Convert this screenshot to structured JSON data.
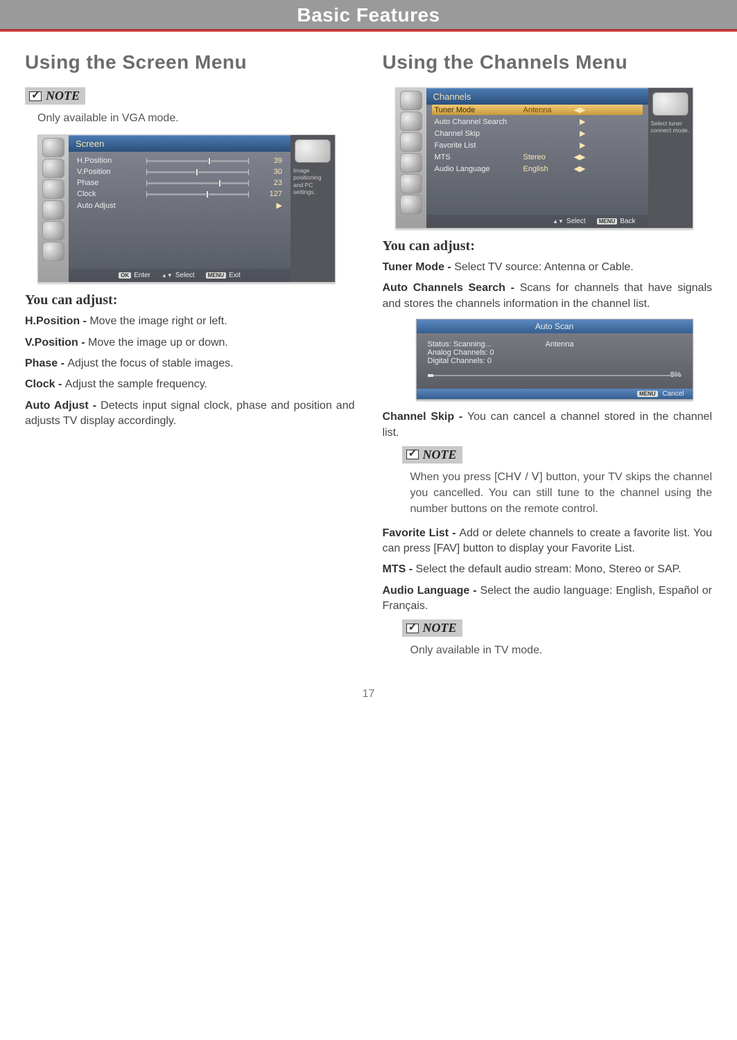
{
  "header": {
    "title": "Basic Features"
  },
  "page_number": "17",
  "left": {
    "heading": "Using the Screen Menu",
    "note_label": "NOTE",
    "note_text": "Only available in VGA mode.",
    "osd": {
      "title": "Screen",
      "side_caption": "Image positioning and PC settings.",
      "rows": [
        {
          "label": "H.Position",
          "value": "39",
          "thumb": 60
        },
        {
          "label": "V.Position",
          "value": "30",
          "thumb": 48
        },
        {
          "label": "Phase",
          "value": "23",
          "thumb": 70
        },
        {
          "label": "Clock",
          "value": "127",
          "thumb": 58
        },
        {
          "label": "Auto Adjust",
          "arrow": "▶"
        }
      ],
      "footer": {
        "enter": "Enter",
        "select": "Select",
        "exit": "Exit",
        "ok": "OK",
        "menu": "MENU"
      }
    },
    "adjust_head": "You can adjust:",
    "items": [
      {
        "b": "H.Position - ",
        "t": "Move the image right or left."
      },
      {
        "b": "V.Position - ",
        "t": "Move the image up or down."
      },
      {
        "b": "Phase - ",
        "t": "Adjust the focus of stable images."
      },
      {
        "b": "Clock - ",
        "t": "Adjust the sample frequency."
      },
      {
        "b": "Auto Adjust - ",
        "t": "Detects input signal clock, phase and position and adjusts TV display accordingly."
      }
    ]
  },
  "right": {
    "heading": "Using the Channels Menu",
    "osd": {
      "title": "Channels",
      "side_caption": "Select tuner connect mode.",
      "rows": [
        {
          "label": "Tuner Mode",
          "value": "Antenna",
          "sel": true,
          "lr": true
        },
        {
          "label": "Auto Channel Search",
          "arrow": "▶"
        },
        {
          "label": "Channel Skip",
          "arrow": "▶"
        },
        {
          "label": "Favorite List",
          "arrow": "▶"
        },
        {
          "label": "MTS",
          "value": "Stereo",
          "lr": true
        },
        {
          "label": "Audio Language",
          "value": "English",
          "lr": true
        }
      ],
      "footer": {
        "select": "Select",
        "back": "Back",
        "menu": "MENU"
      }
    },
    "adjust_head": "You can adjust:",
    "tuner": {
      "b": "Tuner Mode - ",
      "t": "Select TV source: Antenna or Cable."
    },
    "autosrch": {
      "b": "Auto Channels Search - ",
      "t": "Scans for channels that have signals and stores the channels information in the channel list."
    },
    "scan": {
      "title": "Auto Scan",
      "status": "Status: Scanning...",
      "source": "Antenna",
      "analog": "Analog Channels: 0",
      "digital": "Digital Channels: 0",
      "pct": "8%",
      "cancel": "Cancel",
      "menu": "MENU"
    },
    "chskip": {
      "b": "Channel Skip - ",
      "t": "You can cancel a channel stored in the channel list."
    },
    "note1_label": "NOTE",
    "note1_text": "When you press [CHⅤ / Ⅴ] button, your TV skips the channel you cancelled. You can still tune to the channel using the number buttons on the remote control.",
    "fav": {
      "b": "Favorite List - ",
      "t": "Add or delete channels to create a favorite list. You can press [FAV] button to display your Favorite List."
    },
    "mts": {
      "b": "MTS - ",
      "t": "Select the default audio stream: Mono, Stereo or SAP."
    },
    "alang": {
      "b": "Audio Language - ",
      "t": "Select the audio language: English, Español or Français."
    },
    "note2_label": "NOTE",
    "note2_text": "Only available in TV mode."
  }
}
